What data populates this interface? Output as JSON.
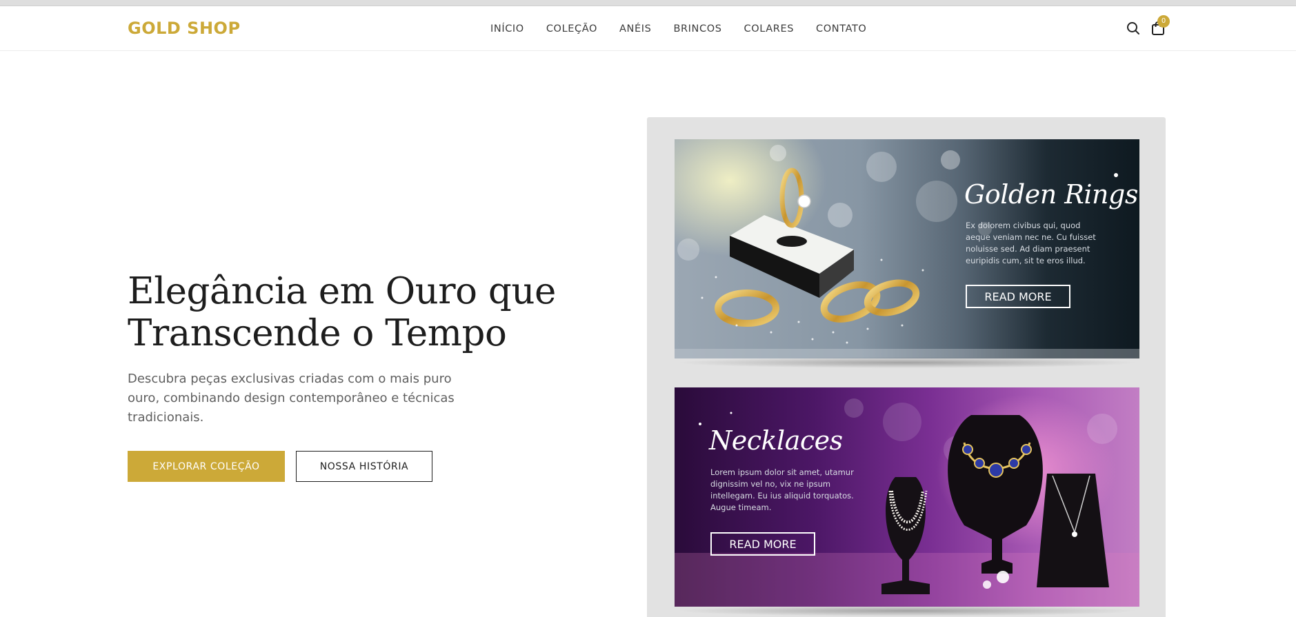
{
  "brand": {
    "name": "GOLD SHOP",
    "accent": "#cca938"
  },
  "nav": {
    "items": [
      "INÍCIO",
      "COLEÇÃO",
      "ANÉIS",
      "BRINCOS",
      "COLARES",
      "CONTATO"
    ]
  },
  "header_icons": {
    "search": "search-icon",
    "cart": "shopping-bag-icon",
    "cart_count": "0"
  },
  "hero": {
    "title_line1": "Elegância em Ouro que",
    "title_line2": "Transcende o Tempo",
    "subtitle": "Descubra peças exclusivas criadas com o mais puro ouro, combinando design contemporâneo e técnicas tradicionais.",
    "primary_button": "EXPLORAR COLEÇÃO",
    "secondary_button": "NOSSA HISTÓRIA"
  },
  "banners": [
    {
      "title": "Golden Rings",
      "text": "Ex dolorem civibus qui, quod aeque veniam nec ne. Cu fuisset noluisse sed. Ad diam praesent euripidis cum, sit te eros illud.",
      "button": "READ MORE"
    },
    {
      "title": "Necklaces",
      "text": "Lorem ipsum dolor sit amet, utamur dignissim vel no, vix ne ipsum intellegam. Eu ius aliquid torquatos. Augue timeam.",
      "button": "READ MORE"
    }
  ]
}
